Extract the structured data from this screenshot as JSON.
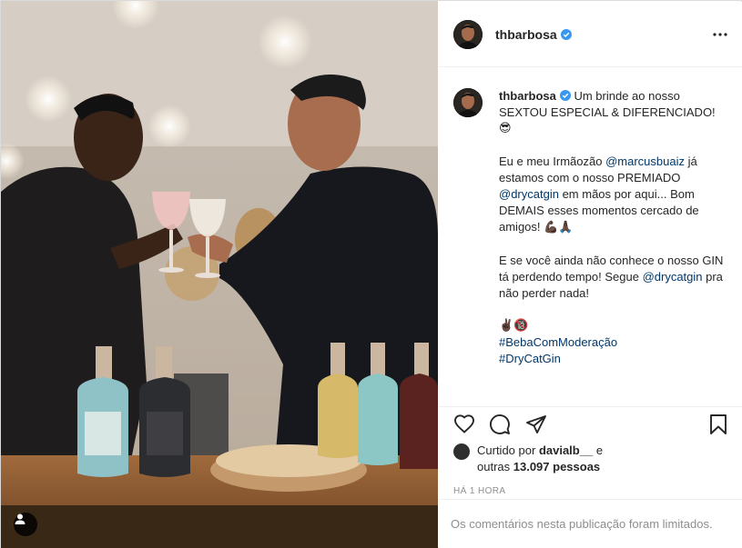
{
  "post": {
    "username": "thbarbosa",
    "verified": true,
    "caption": {
      "username": "thbarbosa",
      "line1": "Um brinde ao nosso SEXTOU ESPECIAL & DIFERENCIADO!",
      "line1_emoji": "😎",
      "p2_a": "Eu e meu Irmãozão ",
      "p2_mention1": "@marcusbuaiz",
      "p2_b": " já estamos com o nosso PREMIADO ",
      "p2_mention2": "@drycatgin",
      "p2_c": " em mãos por aqui... Bom DEMAIS esses momentos cercado de amigos!",
      "p2_emoji": "💪🏿🙏🏿",
      "p3_a": "E se você ainda não conhece o nosso GIN tá perdendo tempo! Segue ",
      "p3_mention": "@drycatgin",
      "p3_b": " pra não perder nada!",
      "p4_emoji": "✌🏿🔞",
      "hashtag1": "#BebaComModeração",
      "hashtag2": "#DryCatGin"
    },
    "likes": {
      "prefix": "Curtido por",
      "user": "davialb__",
      "mid": " e",
      "others_prefix": "outras ",
      "others_count": "13.097 pessoas"
    },
    "time": "HÁ 1 HORA",
    "comments_limited": "Os comentários nesta publicação foram limitados."
  },
  "icons": {
    "more": "more-horizontal-icon",
    "like": "heart-icon",
    "comment": "comment-icon",
    "share": "share-icon",
    "save": "bookmark-icon",
    "user_tag": "user-tag-icon",
    "verified": "verified-badge-icon"
  },
  "colors": {
    "verified": "#3897f0",
    "link": "#00376b",
    "muted": "#8e8e8e",
    "border": "#efefef"
  }
}
